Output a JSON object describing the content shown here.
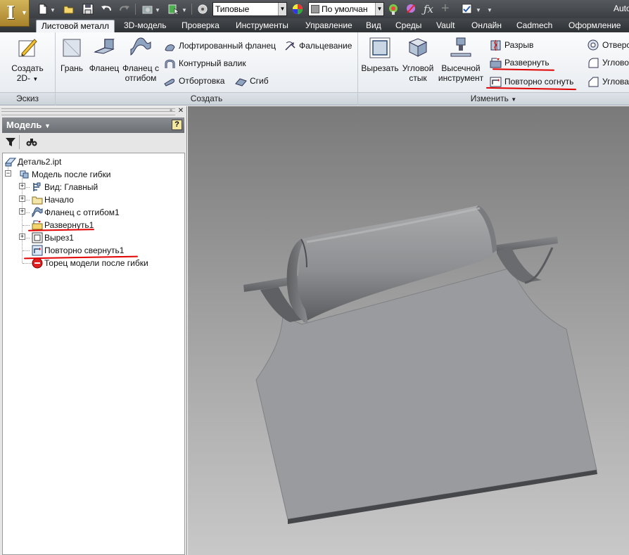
{
  "quick_access": {
    "style_combo": "Типовые",
    "material_combo": "По умолчан",
    "app_title": "Auto",
    "icons": [
      "app-menu-icon",
      "new-file-icon",
      "open-icon",
      "save-icon",
      "undo-icon",
      "redo-icon",
      "appearance-icon",
      "select-icon",
      "material-icon",
      "color-wheel-icon",
      "adjust-icon",
      "clear-icon",
      "fx-icon",
      "plus-icon",
      "checkbox-icon"
    ]
  },
  "tabs": [
    "Листовой металл",
    "3D-модель",
    "Проверка",
    "Инструменты",
    "Управление",
    "Вид",
    "Среды",
    "Vault",
    "Онлайн",
    "Cadmech",
    "Оформление"
  ],
  "ribbon": {
    "sketch": {
      "create_2d": "Создать 2D-",
      "panel_title": "Эскиз"
    },
    "create": {
      "face": "Грань",
      "flange": "Фланец",
      "contour_flange": "Фланец с отгибом",
      "lofted_flange": "Лофтированный фланец",
      "contour_roll": "Контурный валик",
      "hem": "Отбортовка",
      "fold": "Фальцевание",
      "bend": "Сгиб",
      "panel_title": "Создать"
    },
    "modify": {
      "cut": "Вырезать",
      "corner_seam": "Угловой стык",
      "punch_tool": "Высечной инструмент",
      "rip": "Разрыв",
      "unfold": "Развернуть",
      "refold": "Повторно согнуть",
      "hole": "Отверс",
      "corner_round": "Углово",
      "corner_chamfer": "Углова",
      "panel_title": "Изменить"
    }
  },
  "browser": {
    "title": "Модель",
    "help": "?",
    "tree": [
      {
        "label": "Деталь2.ipt",
        "icon": "part-icon"
      },
      {
        "label": "Модель после гибки",
        "icon": "folded-model-icon"
      },
      {
        "label": "Вид: Главный",
        "icon": "view-icon"
      },
      {
        "label": "Начало",
        "icon": "folder-icon"
      },
      {
        "label": "Фланец с отгибом1",
        "icon": "contour-flange-icon"
      },
      {
        "label": "Развернуть1",
        "icon": "unfold-icon"
      },
      {
        "label": "Вырез1",
        "icon": "cut-icon"
      },
      {
        "label": "Повторно свернуть1",
        "icon": "refold-icon"
      },
      {
        "label": "Торец модели после гибки",
        "icon": "end-of-part-icon"
      }
    ]
  },
  "colors": {
    "annotation_red": "#e00000",
    "viewport_top": "#7a7a7a",
    "viewport_bottom": "#c8c8c8",
    "part_face": "#9a9b9e"
  }
}
